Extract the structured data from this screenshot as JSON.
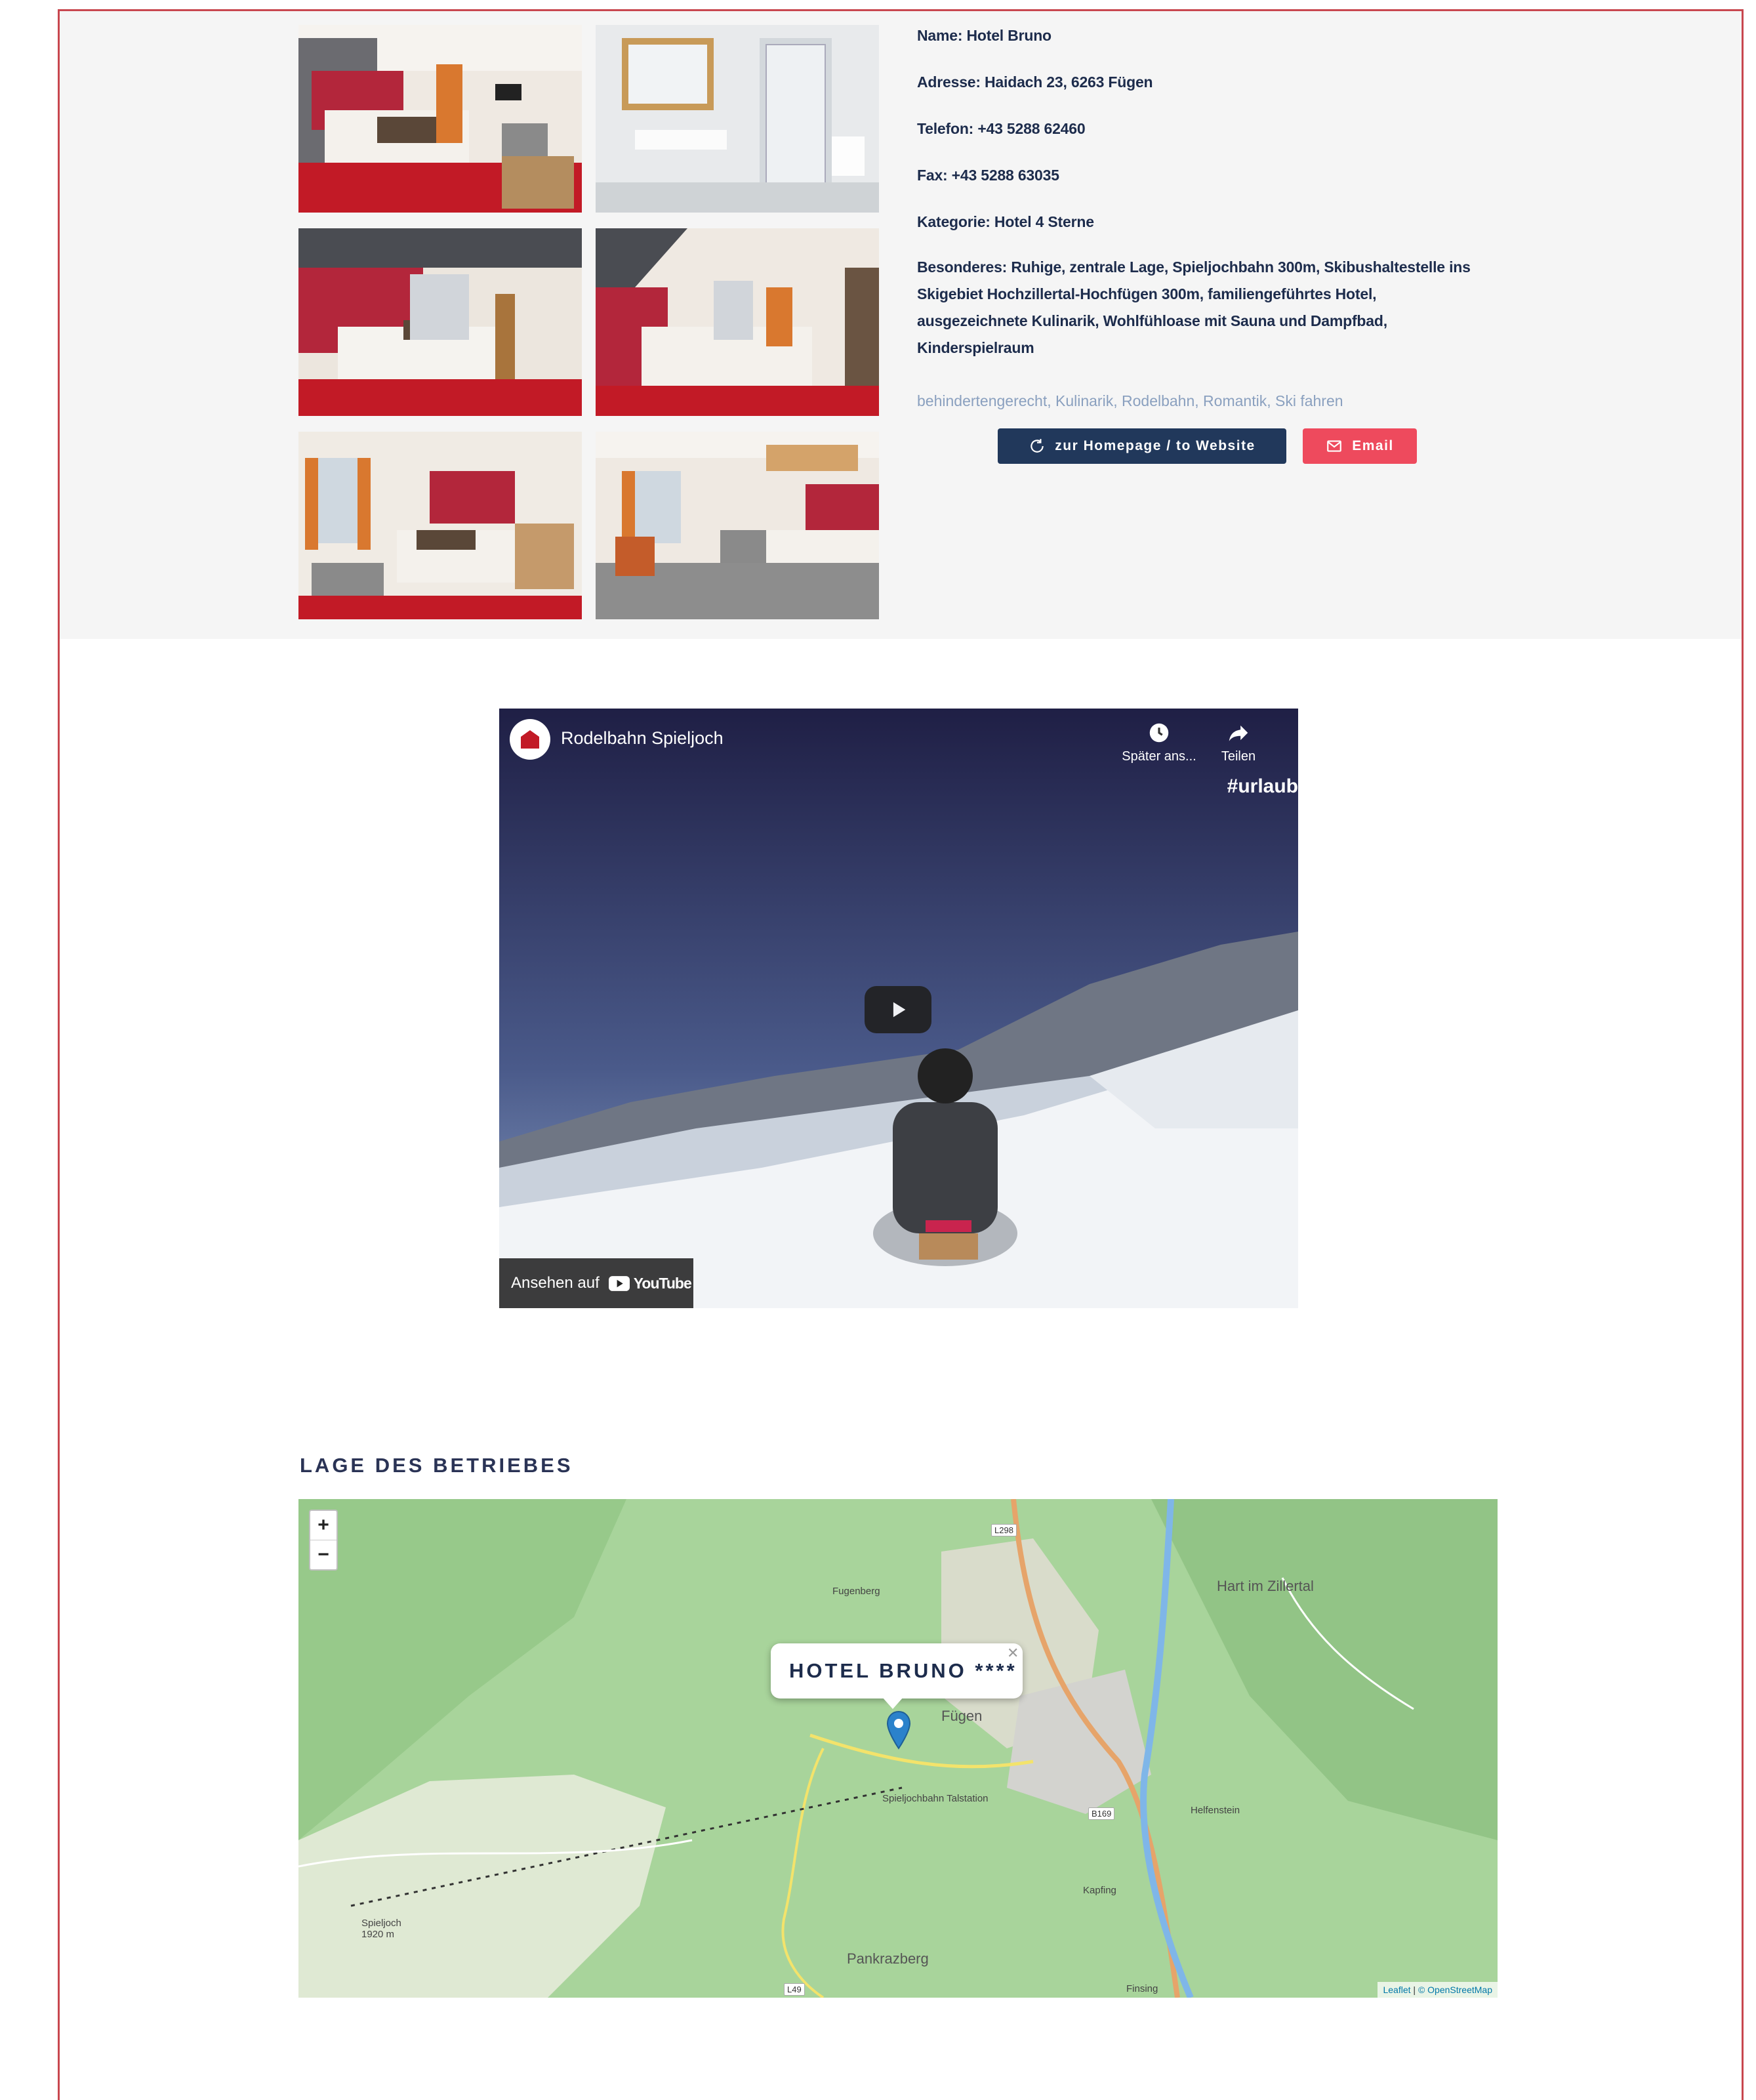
{
  "hotel": {
    "name_line": "Name: Hotel Bruno",
    "address_line": "Adresse: Haidach 23, 6263 Fügen",
    "phone_line": "Telefon: +43 5288 62460",
    "fax_line": "Fax: +43 5288 63035",
    "category_line": "Kategorie: Hotel 4 Sterne",
    "special_line": "Besonderes: Ruhige, zentrale Lage, Spieljochbahn 300m, Skibushaltestelle ins Skigebiet Hochzillertal-Hochfügen 300m, familiengeführtes Hotel, ausgezeichnete Kulinarik, Wohlfühloase mit Sauna und Dampfbad, Kinderspielraum",
    "tags": [
      "behindertengerecht",
      "Kulinarik",
      "Rodelbahn",
      "Romantik",
      "Ski fahren"
    ]
  },
  "buttons": {
    "homepage_label": "zur Homepage / to Website",
    "email_label": "Email"
  },
  "video": {
    "title": "Rodelbahn Spieljoch",
    "watch_later_label": "Später ans...",
    "share_label": "Teilen",
    "hashtag": "#urlaub",
    "watch_on_label": "Ansehen auf",
    "youtube_label": "YouTube"
  },
  "map": {
    "heading": "LAGE DES BETRIEBES",
    "popup_title": "HOTEL BRUNO ****",
    "zoom_in": "+",
    "zoom_out": "−",
    "attribution_leaflet": "Leaflet",
    "attribution_osm": "© OpenStreetMap",
    "labels": {
      "fugenberg": "Fugenberg",
      "hart": "Hart im Zillertal",
      "fugen": "Fügen",
      "pankrazberg": "Pankrazberg",
      "kapfing": "Kapfing",
      "helfenstein": "Helfenstein",
      "spieljoch": "Spieljoch 1920 m",
      "talstation": "Spieljochbahn Talstation",
      "finsing": "Finsing"
    },
    "roads": {
      "l298": "L298",
      "b169": "B169",
      "l49": "L49"
    }
  },
  "colors": {
    "frame_border": "#c8474f",
    "navy_button": "#21385b",
    "email_button": "#ee4a5d",
    "tag_link": "#8aa0bf",
    "text_dark": "#1d2c4c"
  }
}
